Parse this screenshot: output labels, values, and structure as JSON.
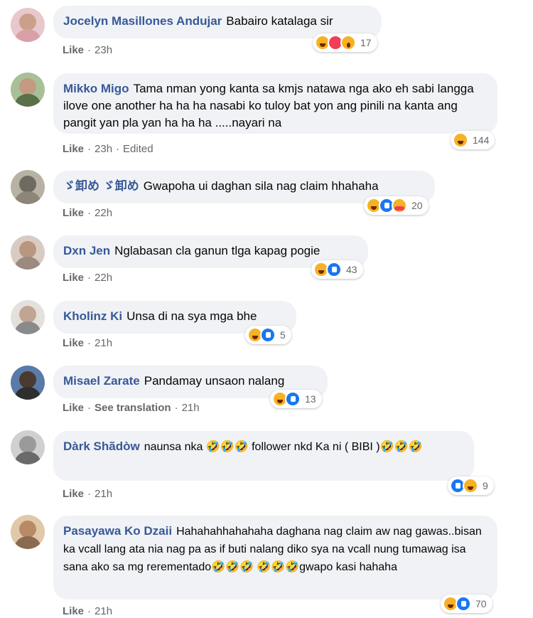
{
  "comments": [
    {
      "author": "Jocelyn Masillones Andujar",
      "text": "Babairo katalaga sir",
      "actions": {
        "like": "Like",
        "time": "23h"
      },
      "reactions": [
        "haha",
        "love",
        "wow"
      ],
      "count": "17",
      "avatar_color": "#d9a0a8"
    },
    {
      "author": "Mikko Migo",
      "text": "Tama nman yong kanta sa kmjs natawa nga ako eh sabi langga ilove one another ha ha ha nasabi ko tuloy bat yon ang pinili na kanta ang pangit yan pla yan ha ha ha .....nayari na",
      "actions": {
        "like": "Like",
        "time": "23h",
        "edited": "Edited"
      },
      "reactions": [
        "haha"
      ],
      "count": "144",
      "avatar_color": "#7a9a6a"
    },
    {
      "author": "ゞ卸め ゞ卸め",
      "text": "Gwapoha ui daghan sila nag claim hhahaha",
      "actions": {
        "like": "Like",
        "time": "22h"
      },
      "reactions": [
        "haha",
        "like",
        "care"
      ],
      "count": "20",
      "avatar_color": "#8d8578"
    },
    {
      "author": "Dxn Jen",
      "text": "Nglabasan cla ganun tlga kapag pogie",
      "actions": {
        "like": "Like",
        "time": "22h"
      },
      "reactions": [
        "haha",
        "like"
      ],
      "count": "43",
      "avatar_color": "#b9a9a0"
    },
    {
      "author": "Kholinz Ki",
      "text": "Unsa di na sya mga bhe",
      "actions": {
        "like": "Like",
        "time": "21h"
      },
      "reactions": [
        "haha",
        "like"
      ],
      "count": "5",
      "avatar_color": "#c8c2bc"
    },
    {
      "author": "Misael Zarate",
      "text": "Pandamay unsaon nalang",
      "actions": {
        "like": "Like",
        "translate": "See translation",
        "time": "21h"
      },
      "reactions": [
        "haha",
        "like"
      ],
      "count": "13",
      "avatar_color": "#3a5a8a"
    },
    {
      "author": "Dàrk Shãdòw",
      "text": "naunsa nka 🤣🤣🤣 follower nkd Ka ni ( BIBI )🤣🤣🤣",
      "actions": {
        "like": "Like",
        "time": "21h"
      },
      "reactions": [
        "like",
        "haha"
      ],
      "count": "9",
      "avatar_color": "#b0b0b0"
    },
    {
      "author": "Pasayawa Ko Dzaii",
      "text": "Hahahahhahahaha daghana nag claim aw nag gawas..bisan ka vcall lang ata nia nag pa as if buti nalang diko sya na vcall nung tumawag isa sana ako sa mg rerementado🤣🤣🤣 🤣🤣🤣gwapo kasi hahaha",
      "actions": {
        "like": "Like",
        "time": "21h"
      },
      "reactions": [
        "haha",
        "like"
      ],
      "count": "70",
      "avatar_color": "#c4a482"
    }
  ],
  "colors": {
    "author": "#385898",
    "bubble": "#f0f2f5",
    "meta": "#65676b"
  }
}
